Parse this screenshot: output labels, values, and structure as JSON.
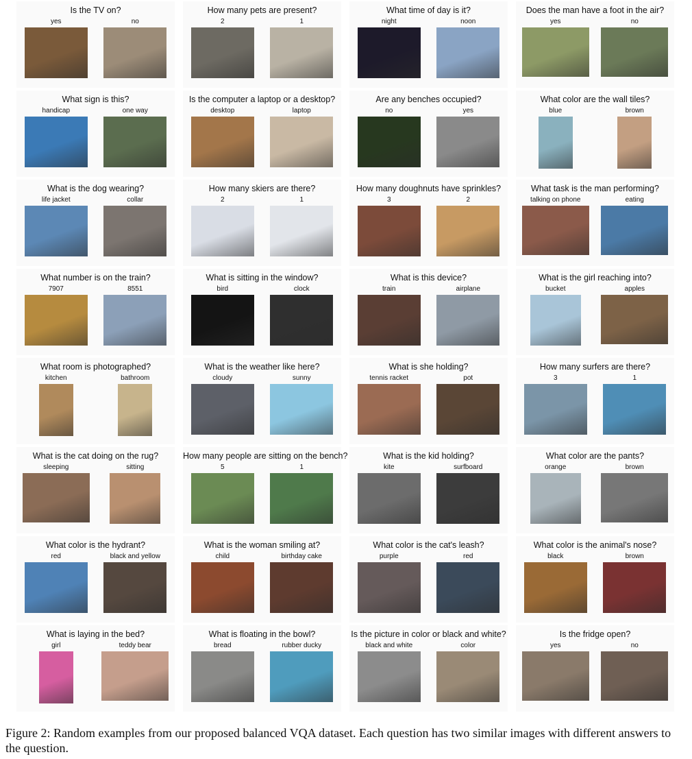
{
  "figure": {
    "caption": "Figure 2: Random examples from our proposed balanced VQA dataset. Each question has two similar images with different answers to the question.",
    "examples": [
      {
        "question": "Is the TV on?",
        "answers": [
          "yes",
          "no"
        ],
        "colors": [
          "#7a5a3a",
          "#9c8c78"
        ]
      },
      {
        "question": "How many pets are present?",
        "answers": [
          "2",
          "1"
        ],
        "colors": [
          "#6d6a62",
          "#b9b2a4"
        ]
      },
      {
        "question": "What time of day is it?",
        "answers": [
          "night",
          "noon"
        ],
        "colors": [
          "#1d1a2a",
          "#8aa4c4"
        ]
      },
      {
        "question": "Does the man have a foot in the air?",
        "answers": [
          "yes",
          "no"
        ],
        "colors": [
          "#8d9a66",
          "#6b7a58"
        ]
      },
      {
        "question": "What sign is this?",
        "answers": [
          "handicap",
          "one way"
        ],
        "colors": [
          "#3b7ab6",
          "#5b6d4f"
        ]
      },
      {
        "question": "Is the computer a laptop or a desktop?",
        "answers": [
          "desktop",
          "laptop"
        ],
        "colors": [
          "#a3764a",
          "#c9b9a4"
        ]
      },
      {
        "question": "Are any benches occupied?",
        "answers": [
          "no",
          "yes"
        ],
        "colors": [
          "#27381f",
          "#8a8a8a"
        ]
      },
      {
        "question": "What color are the wall tiles?",
        "answers": [
          "blue",
          "brown"
        ],
        "colors": [
          "#8ab1be",
          "#c39f82"
        ]
      },
      {
        "question": "What is the dog wearing?",
        "answers": [
          "life jacket",
          "collar"
        ],
        "colors": [
          "#5c88b5",
          "#7c7570"
        ]
      },
      {
        "question": "How many skiers are there?",
        "answers": [
          "2",
          "1"
        ],
        "colors": [
          "#d9dde5",
          "#e2e5ea"
        ]
      },
      {
        "question": "How many doughnuts have sprinkles?",
        "answers": [
          "3",
          "2"
        ],
        "colors": [
          "#7c4b3a",
          "#c79a63"
        ]
      },
      {
        "question": "What task is the man performing?",
        "answers": [
          "talking on phone",
          "eating"
        ],
        "colors": [
          "#8b5a4a",
          "#4b7aa6"
        ]
      },
      {
        "question": "What number is on the train?",
        "answers": [
          "7907",
          "8551"
        ],
        "colors": [
          "#b68b3f",
          "#8ca0b8"
        ]
      },
      {
        "question": "What is sitting in the window?",
        "answers": [
          "bird",
          "clock"
        ],
        "colors": [
          "#141414",
          "#2f2f2f"
        ]
      },
      {
        "question": "What is this device?",
        "answers": [
          "train",
          "airplane"
        ],
        "colors": [
          "#5a3e34",
          "#8f9aa5"
        ]
      },
      {
        "question": "What is the girl reaching into?",
        "answers": [
          "bucket",
          "apples"
        ],
        "colors": [
          "#a9c5d8",
          "#7d6247"
        ]
      },
      {
        "question": "What room is photographed?",
        "answers": [
          "kitchen",
          "bathroom"
        ],
        "colors": [
          "#b08a5c",
          "#c7b48c"
        ]
      },
      {
        "question": "What is the weather like here?",
        "answers": [
          "cloudy",
          "sunny"
        ],
        "colors": [
          "#5d6068",
          "#8cc6e0"
        ]
      },
      {
        "question": "What is she holding?",
        "answers": [
          "tennis racket",
          "pot"
        ],
        "colors": [
          "#9b6b53",
          "#5a4636"
        ]
      },
      {
        "question": "How many surfers are there?",
        "answers": [
          "3",
          "1"
        ],
        "colors": [
          "#7b95a8",
          "#4f8eb6"
        ]
      },
      {
        "question": "What is the cat doing on the rug?",
        "answers": [
          "sleeping",
          "sitting"
        ],
        "colors": [
          "#8b6c56",
          "#b99070"
        ]
      },
      {
        "question": "How many people are sitting on the bench?",
        "answers": [
          "5",
          "1"
        ],
        "colors": [
          "#6b8b54",
          "#4f7a4b"
        ]
      },
      {
        "question": "What is the kid holding?",
        "answers": [
          "kite",
          "surfboard"
        ],
        "colors": [
          "#6c6c6c",
          "#3c3c3c"
        ]
      },
      {
        "question": "What color are the pants?",
        "answers": [
          "orange",
          "brown"
        ],
        "colors": [
          "#a9b4ba",
          "#777777"
        ]
      },
      {
        "question": "What color is the hydrant?",
        "answers": [
          "red",
          "black and yellow"
        ],
        "colors": [
          "#4f82b6",
          "#55483f"
        ]
      },
      {
        "question": "What is the woman smiling at?",
        "answers": [
          "child",
          "birthday cake"
        ],
        "colors": [
          "#8c4a2f",
          "#5e3b2f"
        ]
      },
      {
        "question": "What color is the cat's leash?",
        "answers": [
          "purple",
          "red"
        ],
        "colors": [
          "#655a5a",
          "#3b4a5a"
        ]
      },
      {
        "question": "What color is the animal's nose?",
        "answers": [
          "black",
          "brown"
        ],
        "colors": [
          "#9a6a36",
          "#7a3232"
        ]
      },
      {
        "question": "What is laying in the bed?",
        "answers": [
          "girl",
          "teddy bear"
        ],
        "colors": [
          "#d65ea0",
          "#c59e8c"
        ]
      },
      {
        "question": "What is floating in the bowl?",
        "answers": [
          "bread",
          "rubber ducky"
        ],
        "colors": [
          "#8a8a88",
          "#4f9cbd"
        ]
      },
      {
        "question": "Is the picture in color or black and white?",
        "answers": [
          "black and white",
          "color"
        ],
        "colors": [
          "#8c8c8c",
          "#9a8a76"
        ]
      },
      {
        "question": "Is the fridge open?",
        "answers": [
          "yes",
          "no"
        ],
        "colors": [
          "#8a7a6a",
          "#6f5f54"
        ]
      }
    ]
  }
}
